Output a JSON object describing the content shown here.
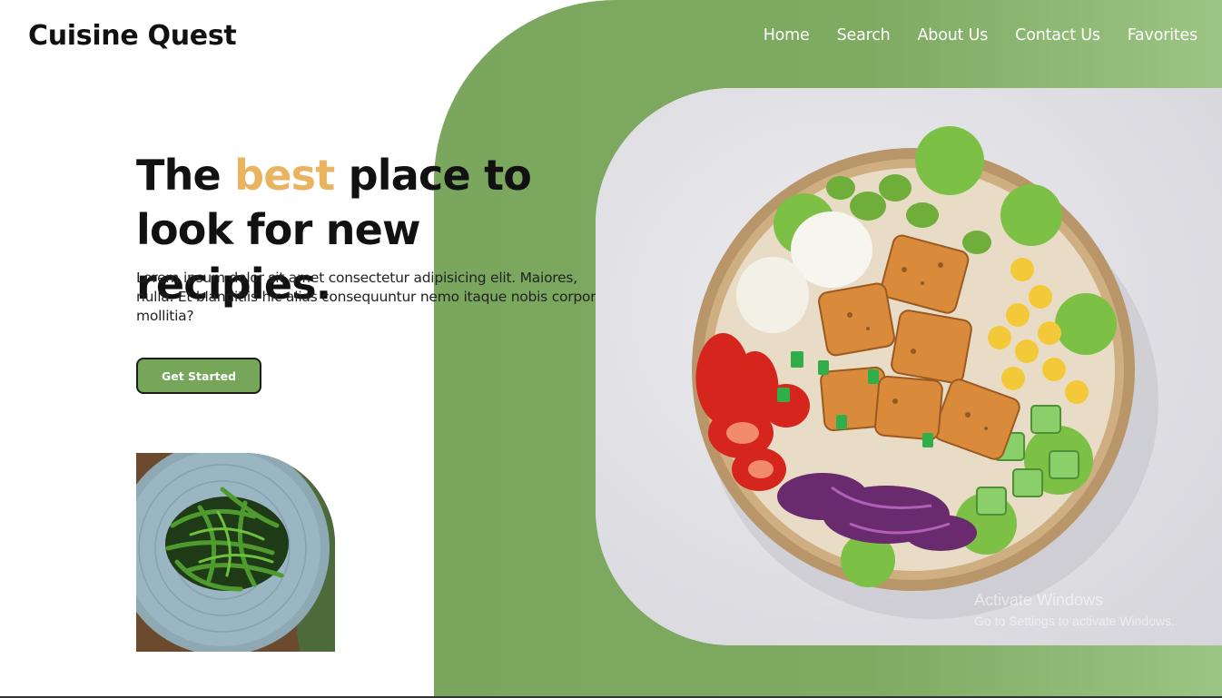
{
  "header": {
    "brand": "Cuisine Quest",
    "nav": [
      {
        "label": "Home"
      },
      {
        "label": "Search"
      },
      {
        "label": "About Us"
      },
      {
        "label": "Contact Us"
      },
      {
        "label": "Favorites"
      }
    ]
  },
  "hero": {
    "title_part1": "The ",
    "title_accent": "best",
    "title_part2": " place to look for new recipies.",
    "body": "Lorem ipsum dolor sit amet consectetur adipisicing elit. Maiores, nulla. Et blanditiis hic alias consequuntur nemo itaque nobis corporis mollitia?",
    "cta_label": "Get Started"
  },
  "watermark": {
    "line1": "Activate Windows",
    "line2": "Go to Settings to activate Windows."
  },
  "colors": {
    "accent": "#e9b35f",
    "brand_green": "#7aa65e",
    "button_green": "#76a65a"
  }
}
